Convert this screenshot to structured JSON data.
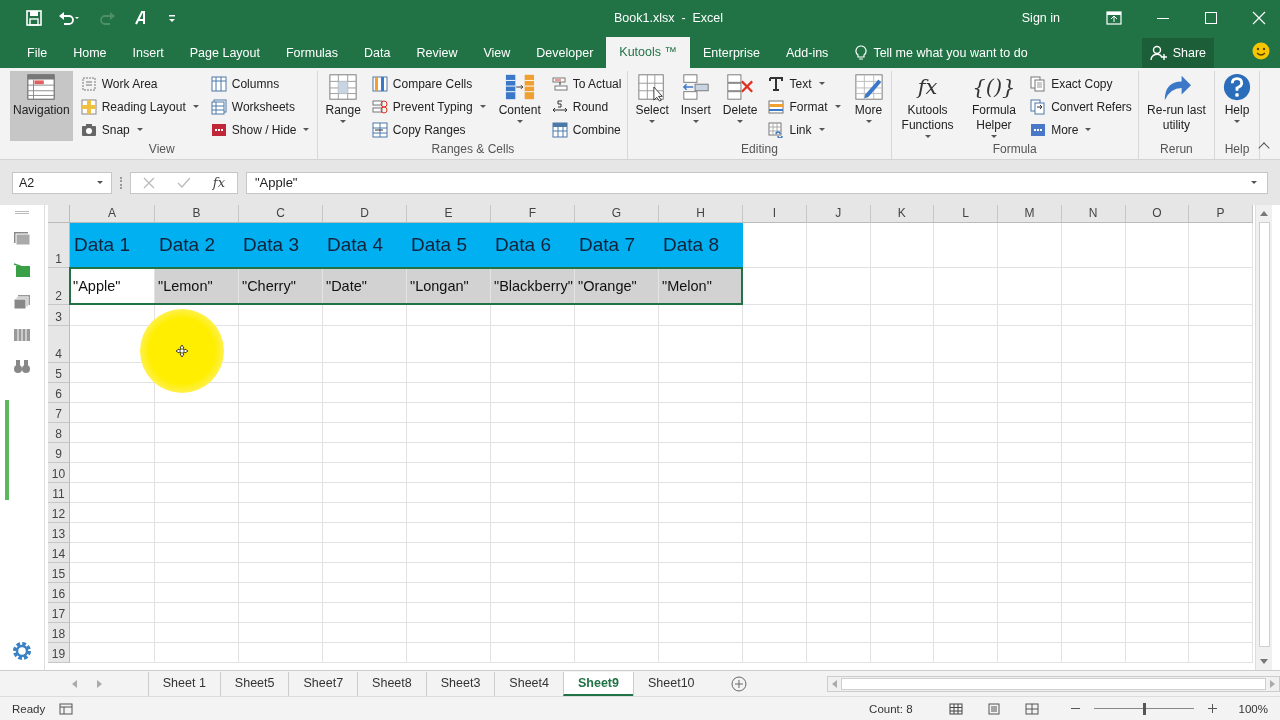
{
  "title_bar": {
    "title": "Book1.xlsx  -  Excel",
    "sign_in": "Sign in"
  },
  "ribbon_tabs": [
    {
      "label": "File",
      "selected": false
    },
    {
      "label": "Home",
      "selected": false
    },
    {
      "label": "Insert",
      "selected": false
    },
    {
      "label": "Page Layout",
      "selected": false
    },
    {
      "label": "Formulas",
      "selected": false
    },
    {
      "label": "Data",
      "selected": false
    },
    {
      "label": "Review",
      "selected": false
    },
    {
      "label": "View",
      "selected": false
    },
    {
      "label": "Developer",
      "selected": false
    },
    {
      "label": "Kutools ™",
      "selected": true
    },
    {
      "label": "Enterprise",
      "selected": false
    },
    {
      "label": "Add-ins",
      "selected": false
    }
  ],
  "tell_me": "Tell me what you want to do",
  "share": "Share",
  "ribbon_groups": [
    {
      "label": "View",
      "columns": [
        {
          "kind": "large",
          "label": "Navigation",
          "dropdown": false,
          "pressed": true
        },
        {
          "kind": "stack",
          "items": [
            {
              "label": "Work Area",
              "dropdown": false
            },
            {
              "label": "Reading Layout",
              "dropdown": true
            },
            {
              "label": "Snap",
              "dropdown": true
            }
          ]
        },
        {
          "kind": "stack",
          "items": [
            {
              "label": "Columns",
              "dropdown": false
            },
            {
              "label": "Worksheets",
              "dropdown": false
            },
            {
              "label": "Show / Hide",
              "dropdown": true
            }
          ]
        }
      ]
    },
    {
      "label": "Ranges & Cells",
      "columns": [
        {
          "kind": "large",
          "label": "Range",
          "dropdown": true,
          "pressed": false
        },
        {
          "kind": "stack",
          "items": [
            {
              "label": "Compare Cells",
              "dropdown": false
            },
            {
              "label": "Prevent Typing",
              "dropdown": true
            },
            {
              "label": "Copy Ranges",
              "dropdown": false
            }
          ]
        },
        {
          "kind": "large",
          "label": "Content",
          "dropdown": true,
          "pressed": false
        },
        {
          "kind": "stack",
          "items": [
            {
              "label": "To Actual",
              "dropdown": false
            },
            {
              "label": "Round",
              "dropdown": false
            },
            {
              "label": "Combine",
              "dropdown": false
            }
          ]
        }
      ]
    },
    {
      "label": "Editing",
      "columns": [
        {
          "kind": "large",
          "label": "Select",
          "dropdown": true,
          "pressed": false
        },
        {
          "kind": "large",
          "label": "Insert",
          "dropdown": true,
          "pressed": false
        },
        {
          "kind": "large",
          "label": "Delete",
          "dropdown": true,
          "pressed": false
        },
        {
          "kind": "stack",
          "items": [
            {
              "label": "Text",
              "dropdown": true
            },
            {
              "label": "Format",
              "dropdown": true
            },
            {
              "label": "Link",
              "dropdown": true
            }
          ]
        },
        {
          "kind": "large",
          "label": "More",
          "dropdown": true,
          "pressed": false
        }
      ]
    },
    {
      "label": "Formula",
      "columns": [
        {
          "kind": "large",
          "label": "Kutools Functions",
          "glyph": "fx",
          "dropdown": true,
          "pressed": false
        },
        {
          "kind": "large",
          "label": "Formula Helper",
          "glyph": "{()}",
          "dropdown": true,
          "pressed": false
        },
        {
          "kind": "stack",
          "items": [
            {
              "label": "Exact Copy",
              "dropdown": false
            },
            {
              "label": "Convert Refers",
              "dropdown": false
            },
            {
              "label": "More",
              "dropdown": true
            }
          ]
        }
      ]
    },
    {
      "label": "Rerun",
      "columns": [
        {
          "kind": "large",
          "label": "Re-run last utility",
          "dropdown": false,
          "pressed": false
        }
      ]
    },
    {
      "label": "Help",
      "columns": [
        {
          "kind": "large",
          "label": "Help",
          "dropdown": true,
          "pressed": false
        }
      ]
    }
  ],
  "formula_bar": {
    "name_box": "A2",
    "function_label": "fx",
    "value": "\"Apple\""
  },
  "grid": {
    "columns": [
      "A",
      "B",
      "C",
      "D",
      "E",
      "F",
      "G",
      "H",
      "I",
      "J",
      "K",
      "L",
      "M",
      "N",
      "O",
      "P"
    ],
    "rows": [
      {
        "label": "1",
        "kind": "header",
        "cells": [
          {
            "text": "Data 1",
            "selected": false
          },
          {
            "text": "Data 2",
            "selected": false
          },
          {
            "text": "Data 3",
            "selected": false
          },
          {
            "text": "Data 4",
            "selected": false
          },
          {
            "text": "Data 5",
            "selected": false
          },
          {
            "text": "Data 6",
            "selected": false
          },
          {
            "text": "Data 7",
            "selected": false
          },
          {
            "text": "Data 8",
            "selected": false
          }
        ]
      },
      {
        "label": "2",
        "kind": "data",
        "cells": [
          {
            "text": "\"Apple\"",
            "selected": false,
            "active": true
          },
          {
            "text": "\"Lemon\"",
            "selected": true
          },
          {
            "text": "\"Cherry\"",
            "selected": true
          },
          {
            "text": "\"Date\"",
            "selected": true
          },
          {
            "text": "\"Longan\"",
            "selected": true
          },
          {
            "text": "\"Blackberry\"",
            "selected": true
          },
          {
            "text": "\"Orange\"",
            "selected": true
          },
          {
            "text": "\"Melon\"",
            "selected": true
          }
        ]
      },
      {
        "label": "3"
      },
      {
        "label": "4"
      },
      {
        "label": "5"
      },
      {
        "label": "6"
      },
      {
        "label": "7"
      },
      {
        "label": "8"
      },
      {
        "label": "9"
      },
      {
        "label": "10"
      },
      {
        "label": "11"
      },
      {
        "label": "12"
      },
      {
        "label": "13"
      },
      {
        "label": "14"
      },
      {
        "label": "15"
      },
      {
        "label": "16"
      },
      {
        "label": "17"
      },
      {
        "label": "18"
      },
      {
        "label": "19"
      }
    ]
  },
  "sheet_tabs": [
    {
      "label": "Sheet 1",
      "selected": false
    },
    {
      "label": "Sheet5",
      "selected": false
    },
    {
      "label": "Sheet7",
      "selected": false
    },
    {
      "label": "Sheet8",
      "selected": false
    },
    {
      "label": "Sheet3",
      "selected": false
    },
    {
      "label": "Sheet4",
      "selected": false
    },
    {
      "label": "Sheet9",
      "selected": true
    },
    {
      "label": "Sheet10",
      "selected": false
    }
  ],
  "status_bar": {
    "status": "Ready",
    "count": "Count: 8",
    "zoom": "100%",
    "zoom_slider": {
      "level": 0.5
    }
  }
}
